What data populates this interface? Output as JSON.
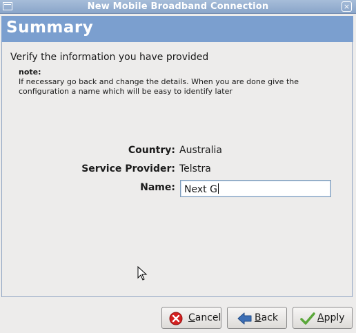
{
  "window": {
    "title": "New Mobile Broadband Connection"
  },
  "header": {
    "title": "Summary"
  },
  "content": {
    "verify_text": "Verify the information you have provided",
    "note_label": "note:",
    "note_text": "If necessary go back and change the details. When you are done give the configuration a name which will be easy to identify later",
    "fields": [
      {
        "label": "Country:",
        "value": "Australia"
      },
      {
        "label": "Service Provider:",
        "value": "Telstra"
      }
    ],
    "name_field": {
      "label": "Name:",
      "value": "Next G"
    }
  },
  "buttons": {
    "cancel": "Cancel",
    "back": "Back",
    "apply": "Apply"
  },
  "colors": {
    "titlebar": "#8aa5c9",
    "header": "#7b9fcf",
    "cancel_icon": "#d42020",
    "back_icon": "#3d6fb5",
    "apply_icon": "#5aa73a"
  },
  "icons": {
    "window_menu": "window-menu-icon",
    "close": "close-icon",
    "cancel": "cancel-icon",
    "back": "back-arrow-icon",
    "apply": "checkmark-icon",
    "pointer": "mouse-pointer-icon"
  }
}
